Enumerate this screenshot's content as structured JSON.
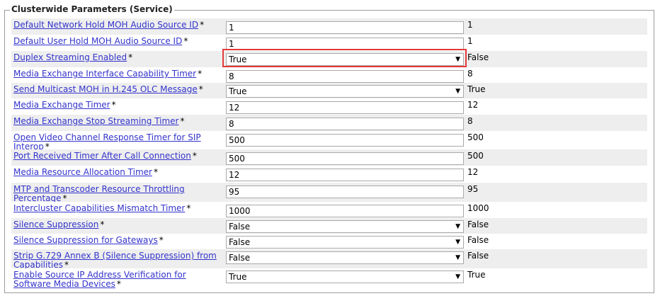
{
  "section": {
    "title": "Clusterwide Parameters (Service)"
  },
  "required_mark": "*",
  "arrow_glyph": "▼",
  "highlight_color": "#e23a3a",
  "rows": [
    {
      "label": "Default Network Hold MOH Audio Source ID",
      "control": "input",
      "value": "1",
      "default": "1"
    },
    {
      "label": "Default User Hold MOH Audio Source ID",
      "control": "input",
      "value": "1",
      "default": "1"
    },
    {
      "label": "Duplex Streaming Enabled",
      "control": "select",
      "value": "True",
      "default": "False"
    },
    {
      "label": "Media Exchange Interface Capability Timer",
      "control": "input",
      "value": "8",
      "default": "8"
    },
    {
      "label": "Send Multicast MOH in H.245 OLC Message",
      "control": "select",
      "value": "True",
      "default": "True"
    },
    {
      "label": "Media Exchange Timer",
      "control": "input",
      "value": "12",
      "default": "12"
    },
    {
      "label": "Media Exchange Stop Streaming Timer",
      "control": "input",
      "value": "8",
      "default": "8"
    },
    {
      "label": "Open Video Channel Response Timer for SIP Interop",
      "control": "input",
      "value": "500",
      "default": "500"
    },
    {
      "label": "Port Received Timer After Call Connection",
      "control": "input",
      "value": "500",
      "default": "500"
    },
    {
      "label": "Media Resource Allocation Timer",
      "control": "input",
      "value": "12",
      "default": "12"
    },
    {
      "label": "MTP and Transcoder Resource Throttling Percentage",
      "control": "input",
      "value": "95",
      "default": "95"
    },
    {
      "label": "Intercluster Capabilities Mismatch Timer",
      "control": "input",
      "value": "1000",
      "default": "1000"
    },
    {
      "label": "Silence Suppression",
      "control": "select",
      "value": "False",
      "default": "False"
    },
    {
      "label": "Silence Suppression for Gateways",
      "control": "select",
      "value": "False",
      "default": "False"
    },
    {
      "label": "Strip G.729 Annex B (Silence Suppression) from Capabilities",
      "control": "select",
      "value": "False",
      "default": "False"
    },
    {
      "label": "Enable Source IP Address Verification for Software Media Devices",
      "control": "select",
      "value": "True",
      "default": "True"
    }
  ]
}
